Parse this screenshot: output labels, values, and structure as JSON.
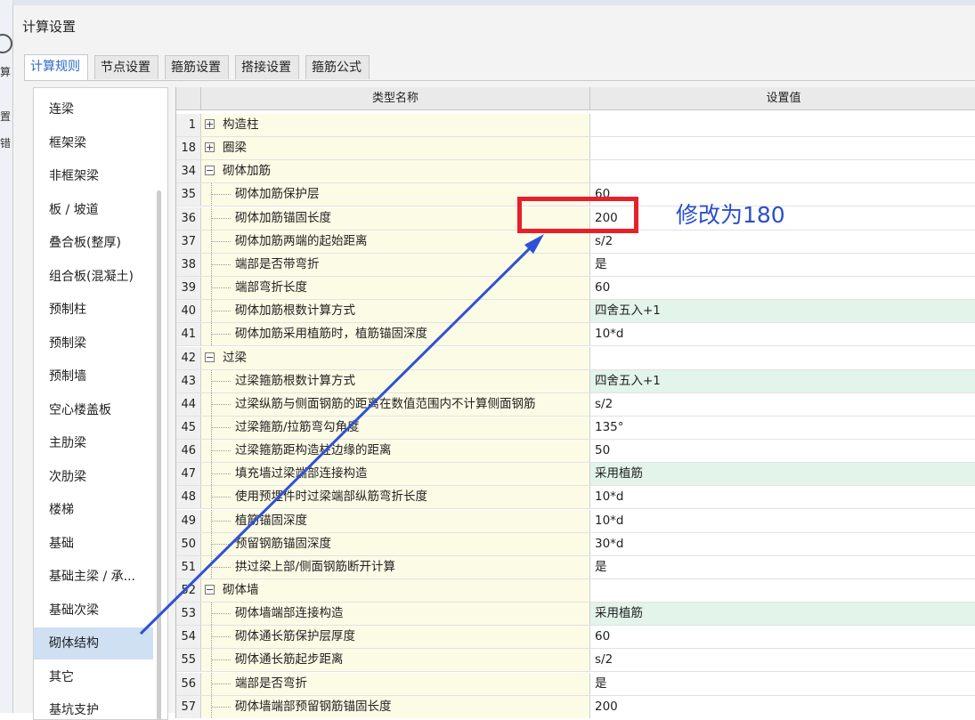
{
  "dialog": {
    "title": "计算设置",
    "tabs": [
      {
        "label": "计算规则",
        "active": true
      },
      {
        "label": "节点设置",
        "active": false
      },
      {
        "label": "箍筋设置",
        "active": false
      },
      {
        "label": "搭接设置",
        "active": false
      },
      {
        "label": "箍筋公式",
        "active": false
      }
    ]
  },
  "background_fragments": [
    "算",
    "置",
    "错"
  ],
  "left_list": [
    {
      "label": "连梁",
      "selected": false
    },
    {
      "label": "框架梁",
      "selected": false
    },
    {
      "label": "非框架梁",
      "selected": false
    },
    {
      "label": "板 / 坡道",
      "selected": false
    },
    {
      "label": "叠合板(整厚)",
      "selected": false
    },
    {
      "label": "组合板(混凝土)",
      "selected": false
    },
    {
      "label": "预制柱",
      "selected": false
    },
    {
      "label": "预制梁",
      "selected": false
    },
    {
      "label": "预制墙",
      "selected": false
    },
    {
      "label": "空心楼盖板",
      "selected": false
    },
    {
      "label": "主肋梁",
      "selected": false
    },
    {
      "label": "次肋梁",
      "selected": false
    },
    {
      "label": "楼梯",
      "selected": false
    },
    {
      "label": "基础",
      "selected": false
    },
    {
      "label": "基础主梁 / 承...",
      "selected": false
    },
    {
      "label": "基础次梁",
      "selected": false
    },
    {
      "label": "砌体结构",
      "selected": true
    },
    {
      "label": "其它",
      "selected": false
    },
    {
      "label": "基坑支护",
      "selected": false
    }
  ],
  "grid": {
    "columns": {
      "name": "类型名称",
      "value": "设置值"
    },
    "rows": [
      {
        "num": "1",
        "kind": "group",
        "expander": "+",
        "name": "构造柱",
        "value": "",
        "green": false
      },
      {
        "num": "18",
        "kind": "group",
        "expander": "+",
        "name": "圈梁",
        "value": "",
        "green": false
      },
      {
        "num": "34",
        "kind": "group",
        "expander": "−",
        "name": "砌体加筋",
        "value": "",
        "green": false
      },
      {
        "num": "35",
        "kind": "child",
        "expander": "",
        "name": "砌体加筋保护层",
        "value": "60",
        "green": false
      },
      {
        "num": "36",
        "kind": "child",
        "expander": "",
        "name": "砌体加筋锚固长度",
        "value": "200",
        "green": false
      },
      {
        "num": "37",
        "kind": "child",
        "expander": "",
        "name": "砌体加筋两端的起始距离",
        "value": "s/2",
        "green": false
      },
      {
        "num": "38",
        "kind": "child",
        "expander": "",
        "name": "端部是否带弯折",
        "value": "是",
        "green": false
      },
      {
        "num": "39",
        "kind": "child",
        "expander": "",
        "name": "端部弯折长度",
        "value": "60",
        "green": false
      },
      {
        "num": "40",
        "kind": "child",
        "expander": "",
        "name": "砌体加筋根数计算方式",
        "value": "四舍五入+1",
        "green": true
      },
      {
        "num": "41",
        "kind": "child",
        "expander": "",
        "name": "砌体加筋采用植筋时，植筋锚固深度",
        "value": "10*d",
        "green": false
      },
      {
        "num": "42",
        "kind": "group",
        "expander": "−",
        "name": "过梁",
        "value": "",
        "green": false
      },
      {
        "num": "43",
        "kind": "child",
        "expander": "",
        "name": "过梁箍筋根数计算方式",
        "value": "四舍五入+1",
        "green": true
      },
      {
        "num": "44",
        "kind": "child",
        "expander": "",
        "name": "过梁纵筋与侧面钢筋的距离在数值范围内不计算侧面钢筋",
        "value": "s/2",
        "green": false
      },
      {
        "num": "45",
        "kind": "child",
        "expander": "",
        "name": "过梁箍筋/拉筋弯勾角度",
        "value": "135°",
        "green": false
      },
      {
        "num": "46",
        "kind": "child",
        "expander": "",
        "name": "过梁箍筋距构造柱边缘的距离",
        "value": "50",
        "green": false
      },
      {
        "num": "47",
        "kind": "child",
        "expander": "",
        "name": "填充墙过梁端部连接构造",
        "value": "采用植筋",
        "green": true
      },
      {
        "num": "48",
        "kind": "child",
        "expander": "",
        "name": "使用预埋件时过梁端部纵筋弯折长度",
        "value": "10*d",
        "green": false
      },
      {
        "num": "49",
        "kind": "child",
        "expander": "",
        "name": "植筋锚固深度",
        "value": "10*d",
        "green": false
      },
      {
        "num": "50",
        "kind": "child",
        "expander": "",
        "name": "预留钢筋锚固深度",
        "value": "30*d",
        "green": false
      },
      {
        "num": "51",
        "kind": "child",
        "expander": "",
        "name": "拱过梁上部/侧面钢筋断开计算",
        "value": "是",
        "green": false
      },
      {
        "num": "52",
        "kind": "group",
        "expander": "−",
        "name": "砌体墙",
        "value": "",
        "green": false
      },
      {
        "num": "53",
        "kind": "child",
        "expander": "",
        "name": "砌体墙端部连接构造",
        "value": "采用植筋",
        "green": true
      },
      {
        "num": "54",
        "kind": "child",
        "expander": "",
        "name": "砌体通长筋保护层厚度",
        "value": "60",
        "green": false
      },
      {
        "num": "55",
        "kind": "child",
        "expander": "",
        "name": "砌体通长筋起步距离",
        "value": "s/2",
        "green": false
      },
      {
        "num": "56",
        "kind": "child",
        "expander": "",
        "name": "端部是否弯折",
        "value": "是",
        "green": false
      },
      {
        "num": "57",
        "kind": "child",
        "expander": "",
        "name": "砌体墙端部预留钢筋锚固长度",
        "value": "200",
        "green": false
      }
    ]
  },
  "annotation": {
    "text": "修改为180",
    "color": "#2b4fc9",
    "highlight_color": "#e8202a"
  }
}
